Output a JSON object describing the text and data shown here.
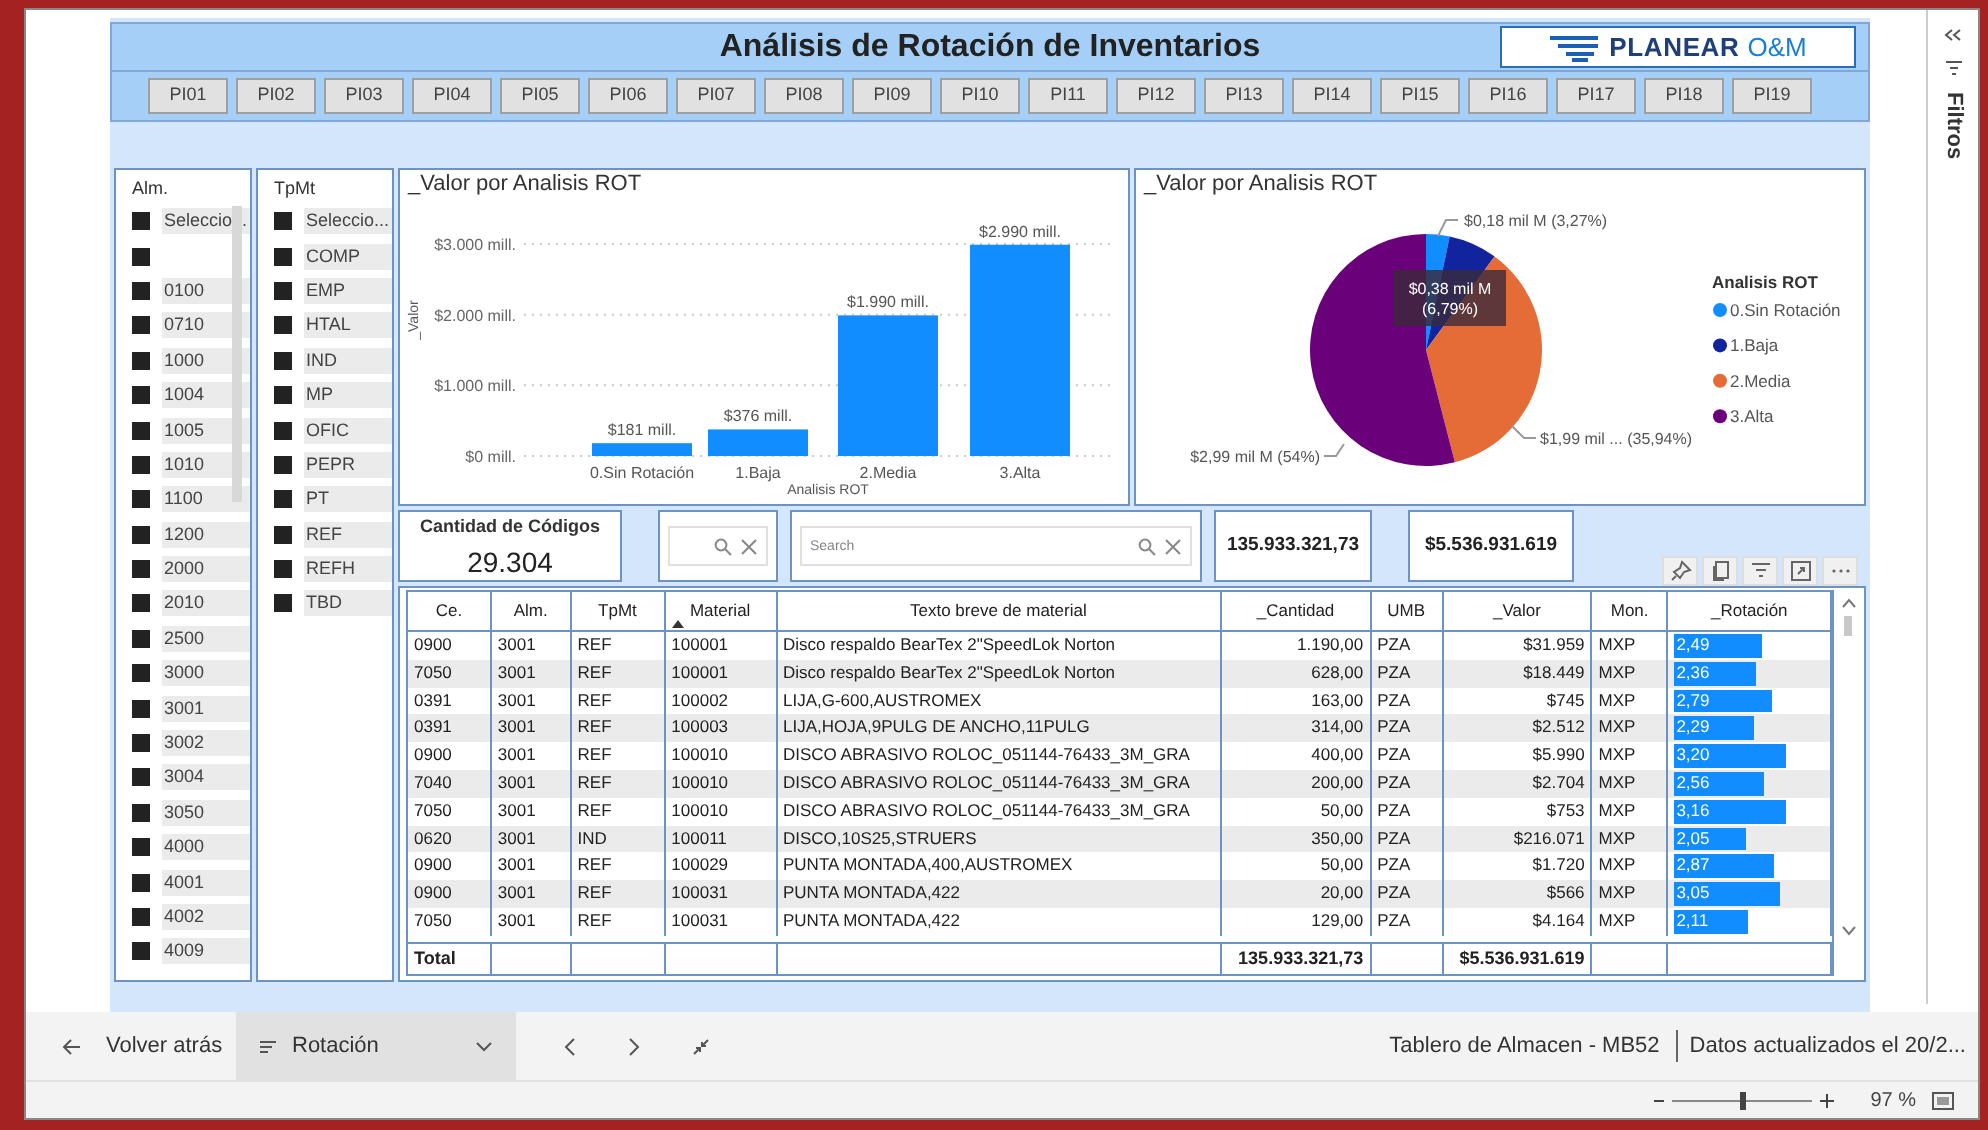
{
  "report": {
    "title": "Análisis de Rotación de Inventarios",
    "logo": {
      "name": "PLANEAR",
      "suffix": "O&M"
    }
  },
  "page_buttons": [
    "PI01",
    "PI02",
    "PI03",
    "PI04",
    "PI05",
    "PI06",
    "PI07",
    "PI08",
    "PI09",
    "PI10",
    "PI11",
    "PI12",
    "PI13",
    "PI14",
    "PI15",
    "PI16",
    "PI17",
    "PI18",
    "PI19"
  ],
  "slicers": [
    {
      "title": "Alm.",
      "items": [
        {
          "label": "Seleccio...",
          "checked": true
        },
        {
          "checked": true
        },
        {
          "label": "0100",
          "checked": true
        },
        {
          "label": "0710",
          "checked": true
        },
        {
          "label": "1000",
          "checked": true
        },
        {
          "label": "1004",
          "checked": true
        },
        {
          "label": "1005",
          "checked": true
        },
        {
          "label": "1010",
          "checked": true
        },
        {
          "label": "1100",
          "checked": true
        },
        {
          "label": "1200",
          "checked": true
        },
        {
          "label": "2000",
          "checked": true
        },
        {
          "label": "2010",
          "checked": true
        },
        {
          "label": "2500",
          "checked": true
        },
        {
          "label": "3000",
          "checked": true
        },
        {
          "label": "3001",
          "checked": true
        },
        {
          "label": "3002",
          "checked": true
        },
        {
          "label": "3004",
          "checked": true
        },
        {
          "label": "3050",
          "checked": true
        },
        {
          "label": "4000",
          "checked": true
        },
        {
          "label": "4001",
          "checked": true
        },
        {
          "label": "4002",
          "checked": true
        },
        {
          "label": "4009",
          "checked": true
        }
      ]
    },
    {
      "title": "TpMt",
      "items": [
        {
          "label": "Seleccio...",
          "checked": true
        },
        {
          "label": "COMP",
          "checked": true
        },
        {
          "label": "EMP",
          "checked": true
        },
        {
          "label": "HTAL",
          "checked": true
        },
        {
          "label": "IND",
          "checked": true
        },
        {
          "label": "MP",
          "checked": true
        },
        {
          "label": "OFIC",
          "checked": true
        },
        {
          "label": "PEPR",
          "checked": true
        },
        {
          "label": "PT",
          "checked": true
        },
        {
          "label": "REF",
          "checked": true
        },
        {
          "label": "REFH",
          "checked": true
        },
        {
          "label": "TBD",
          "checked": true
        }
      ]
    }
  ],
  "bar_chart": {
    "chart_data": {
      "type": "bar",
      "title": "_Valor por Analisis ROT",
      "xlabel": "Analisis ROT",
      "ylabel": "_Valor",
      "categories": [
        "0.Sin Rotación",
        "1.Baja",
        "2.Media",
        "3.Alta"
      ],
      "series": [
        {
          "color": "#118dff",
          "values": [
            181,
            376,
            1990,
            2990
          ]
        }
      ],
      "yticks": [
        {
          "value": 0,
          "label": "$0 mill."
        },
        {
          "value": 1000,
          "label": "$1.000 mill."
        },
        {
          "value": 2000,
          "label": "$2.000 mill."
        },
        {
          "value": 3000,
          "label": "$3.000 mill."
        }
      ],
      "ylim": [
        0,
        3000
      ],
      "value_labels": [
        "$181 mill.",
        "$376 mill.",
        "$1.990 mill.",
        "$2.990 mill."
      ]
    }
  },
  "pie_chart": {
    "legend_title": "Analisis ROT",
    "chart_data": {
      "type": "pie",
      "title": "_Valor por Analisis ROT",
      "categories": [
        "0.Sin Rotación",
        "1.Baja",
        "2.Media",
        "3.Alta"
      ],
      "values": [
        0.181,
        0.376,
        1.99,
        2.99
      ],
      "legend": "right",
      "colors": [
        "#118dff",
        "#12239e",
        "#e66c37",
        "#6b007b"
      ],
      "value_labels": [
        "$0,18 mil M (3,27%)",
        "$0,38 mil M (6,79%)",
        "$1,99 mil ... (35,94%)",
        "$2,99 mil M (54%)"
      ]
    }
  },
  "cards": [
    {
      "kind": "kpi",
      "label": "Cantidad de Códigos",
      "value": "29.304"
    },
    {
      "kind": "search"
    },
    {
      "kind": "search",
      "placeholder": "Search"
    },
    {
      "kind": "total",
      "value": "135.933.321,73"
    },
    {
      "kind": "total",
      "value": "$5.536.931.619"
    }
  ],
  "table": {
    "columns": [
      {
        "label": "Ce.",
        "sorted": false
      },
      {
        "label": "Alm.",
        "sorted": false
      },
      {
        "label": "TpMt",
        "sorted": false
      },
      {
        "label": "Material",
        "sorted": true
      },
      {
        "label": "Texto breve de material",
        "sorted": false
      },
      {
        "label": "_Cantidad",
        "sorted": false
      },
      {
        "label": "UMB",
        "sorted": false
      },
      {
        "label": "_Valor",
        "sorted": false
      },
      {
        "label": "Mon.",
        "sorted": false
      },
      {
        "label": "_Rotación",
        "sorted": false
      }
    ],
    "rows": [
      {
        "cells": [
          "0900",
          "3001",
          "REF",
          "100001",
          "Disco respaldo BearTex 2\"SpeedLok Norton",
          "1.190,00",
          "PZA",
          "$31.959",
          "MXP"
        ],
        "rotation": "2,49",
        "level": 0.58
      },
      {
        "cells": [
          "7050",
          "3001",
          "REF",
          "100001",
          "Disco respaldo BearTex 2\"SpeedLok Norton",
          "628,00",
          "PZA",
          "$18.449",
          "MXP"
        ],
        "rotation": "2,36",
        "level": 0.55
      },
      {
        "cells": [
          "0391",
          "3001",
          "REF",
          "100002",
          "LIJA,G-600,AUSTROMEX",
          "163,00",
          "PZA",
          "$745",
          "MXP"
        ],
        "rotation": "2,79",
        "level": 0.65
      },
      {
        "cells": [
          "0391",
          "3001",
          "REF",
          "100003",
          "LIJA,HOJA,9PULG DE ANCHO,11PULG",
          "314,00",
          "PZA",
          "$2.512",
          "MXP"
        ],
        "rotation": "2,29",
        "level": 0.53
      },
      {
        "cells": [
          "0900",
          "3001",
          "REF",
          "100010",
          "DISCO ABRASIVO ROLOC_051144-76433_3M_GRA",
          "400,00",
          "PZA",
          "$5.990",
          "MXP"
        ],
        "rotation": "3,20",
        "level": 0.75
      },
      {
        "cells": [
          "7040",
          "3001",
          "REF",
          "100010",
          "DISCO ABRASIVO ROLOC_051144-76433_3M_GRA",
          "200,00",
          "PZA",
          "$2.704",
          "MXP"
        ],
        "rotation": "2,56",
        "level": 0.6
      },
      {
        "cells": [
          "7050",
          "3001",
          "REF",
          "100010",
          "DISCO ABRASIVO ROLOC_051144-76433_3M_GRA",
          "50,00",
          "PZA",
          "$753",
          "MXP"
        ],
        "rotation": "3,16",
        "level": 0.74
      },
      {
        "cells": [
          "0620",
          "3001",
          "IND",
          "100011",
          "DISCO,10S25,STRUERS",
          "350,00",
          "PZA",
          "$216.071",
          "MXP"
        ],
        "rotation": "2,05",
        "level": 0.48
      },
      {
        "cells": [
          "0900",
          "3001",
          "REF",
          "100029",
          "PUNTA MONTADA,400,AUSTROMEX",
          "50,00",
          "PZA",
          "$1.720",
          "MXP"
        ],
        "rotation": "2,87",
        "level": 0.67
      },
      {
        "cells": [
          "0900",
          "3001",
          "REF",
          "100031",
          "PUNTA MONTADA,422",
          "20,00",
          "PZA",
          "$566",
          "MXP"
        ],
        "rotation": "3,05",
        "level": 0.71
      },
      {
        "cells": [
          "7050",
          "3001",
          "REF",
          "100031",
          "PUNTA MONTADA,422",
          "129,00",
          "PZA",
          "$4.164",
          "MXP"
        ],
        "rotation": "2,11",
        "level": 0.49
      }
    ],
    "total": {
      "label": "Total",
      "cantidad": "135.933.321,73",
      "valor": "$5.536.931.619"
    }
  },
  "filters_pane": {
    "title": "Filtros",
    "expanded": false
  },
  "footer": {
    "back": "Volver atrás",
    "page": "Rotación",
    "report_name": "Tablero de Almacen - MB52",
    "updated": "Datos actualizados el 20/2...",
    "zoom": "97 %",
    "zoom_slider": {
      "level": 0.5
    }
  }
}
